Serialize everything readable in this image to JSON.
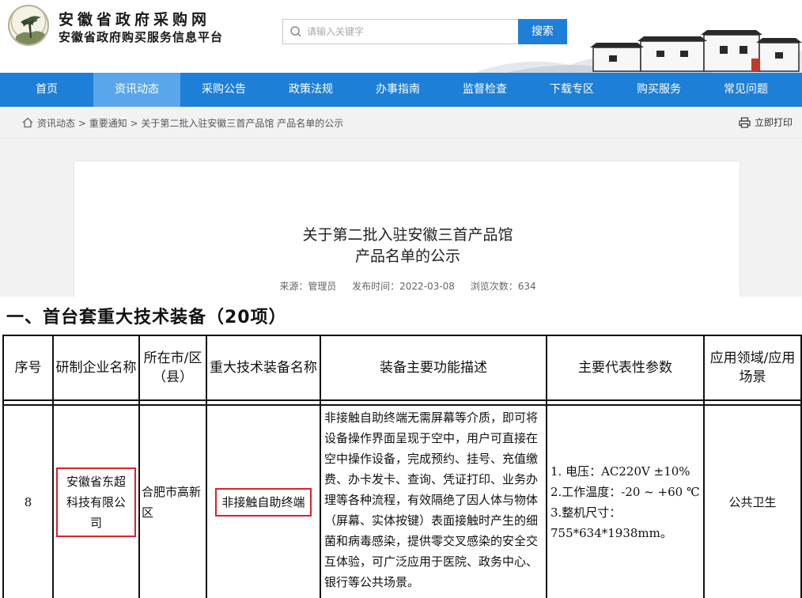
{
  "header": {
    "site_title": "安徽省政府采购网",
    "site_subtitle": "安徽省政府购买服务信息平台",
    "search_placeholder": "请输入关键字",
    "search_button": "搜索"
  },
  "nav": {
    "items": [
      {
        "label": "首页"
      },
      {
        "label": "资讯动态",
        "active": true
      },
      {
        "label": "采购公告"
      },
      {
        "label": "政策法规"
      },
      {
        "label": "办事指南"
      },
      {
        "label": "监督检查"
      },
      {
        "label": "下载专区"
      },
      {
        "label": "购买服务"
      },
      {
        "label": "常见问题"
      }
    ]
  },
  "breadcrumb": {
    "items": [
      "资讯动态",
      "重要通知",
      "关于第二批入驻安徽三首产品馆 产品名单的公示"
    ],
    "separator": " > ",
    "print_label": "立即打印"
  },
  "article": {
    "title_line1": "关于第二批入驻安徽三首产品馆",
    "title_line2": "产品名单的公示",
    "source": "来源：管理员",
    "published": "发布时间：2022-03-08",
    "views": "浏览次数：634"
  },
  "document": {
    "heading": "一、首台套重大技术装备（20项）",
    "table": {
      "headers": [
        "序号",
        "研制企业名称",
        "所在市/区（县）",
        "重大技术装备名称",
        "装备主要功能描述",
        "主要代表性参数",
        "应用领域/应用场景"
      ],
      "row": {
        "number": "8",
        "company": "安徽省东超科技有限公司",
        "location": "合肥市高新区",
        "equipment": "非接触自助终端",
        "description": "非接触自助终端无需屏幕等介质，即可将设备操作界面呈现于空中，用户可直接在空中操作设备，完成预约、挂号、充值缴费、办卡发卡、查询、凭证打印、业务办理等各种流程，有效隔绝了因人体与物体（屏幕、实体按键）表面接触时产生的细菌和病毒感染，提供零交叉感染的安全交互体验，可广泛应用于医院、政务中心、银行等公共场景。",
        "params": [
          "1. 电压：AC220V ±10%",
          "2.工作温度：-20 ~ +60 ℃",
          "3.整机尺寸：755*634*1938mm。"
        ],
        "application": "公共卫生"
      }
    }
  },
  "colors": {
    "nav_blue": "#1e7fd8",
    "nav_active": "#5aa6ea",
    "highlight_red": "#d9232a"
  }
}
